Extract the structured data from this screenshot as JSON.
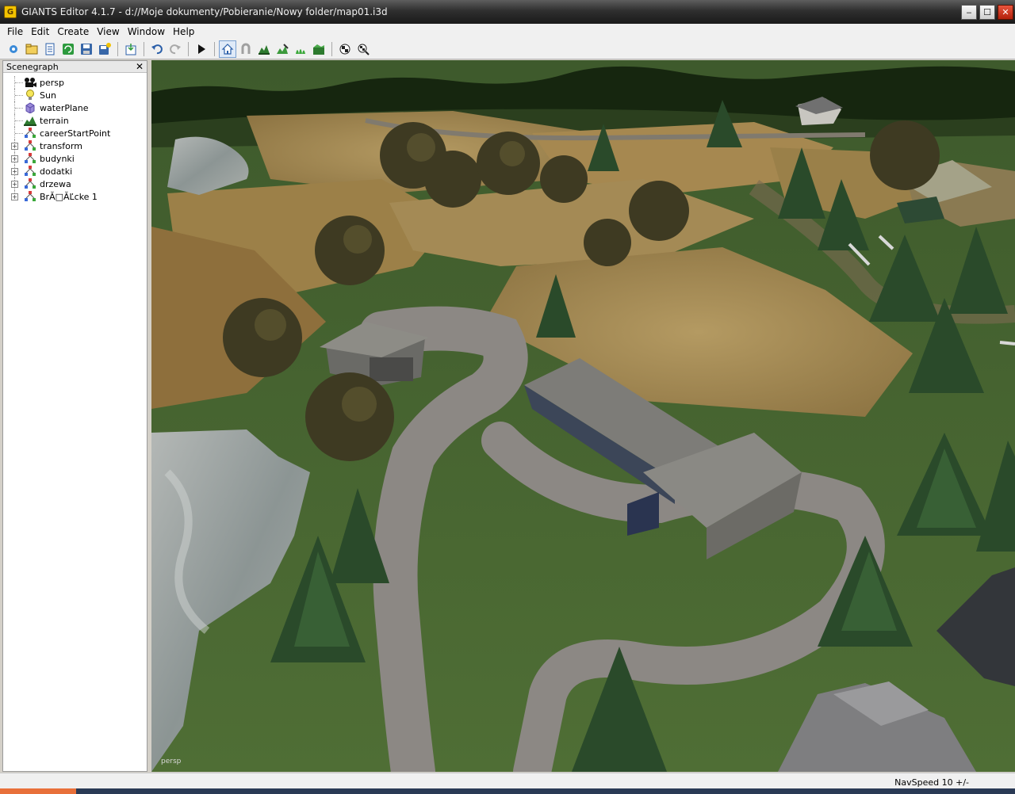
{
  "window": {
    "title": "GIANTS Editor 4.1.7 - d://Moje dokumenty/Pobieranie/Nowy folder/map01.i3d",
    "minimize": "‒",
    "maximize": "☐",
    "close": "✕"
  },
  "menu": [
    "File",
    "Edit",
    "Create",
    "View",
    "Window",
    "Help"
  ],
  "toolbar": {
    "buttons": [
      "new-scene",
      "open",
      "document",
      "refresh",
      "save",
      "save-as",
      "import",
      "undo",
      "redo",
      "play",
      "camera-home",
      "magnet",
      "terrain-sculpt",
      "terrain-paint",
      "foliage-paint",
      "terrain-ops",
      "toggle-a",
      "toggle-b"
    ],
    "active": "camera-home"
  },
  "scenegraph": {
    "title": "Scenegraph",
    "close_label": "✕",
    "items": [
      {
        "label": "persp",
        "icon": "camera-icon",
        "expandable": false
      },
      {
        "label": "Sun",
        "icon": "light-icon",
        "expandable": false
      },
      {
        "label": "waterPlane",
        "icon": "shape-icon",
        "expandable": false
      },
      {
        "label": "terrain",
        "icon": "terrain-icon",
        "expandable": false
      },
      {
        "label": "careerStartPoint",
        "icon": "transform-icon",
        "expandable": false
      },
      {
        "label": "transform",
        "icon": "transform-icon",
        "expandable": true
      },
      {
        "label": "budynki",
        "icon": "transform-icon",
        "expandable": true
      },
      {
        "label": "dodatki",
        "icon": "transform-icon",
        "expandable": true
      },
      {
        "label": "drzewa",
        "icon": "transform-icon",
        "expandable": true
      },
      {
        "label": "BrĂ□ĂĽcke 1",
        "icon": "transform-icon",
        "expandable": true
      }
    ]
  },
  "viewport": {
    "camera_label": "persp"
  },
  "status": {
    "navspeed": "NavSpeed 10 +/-"
  },
  "colors": {
    "title_bar": "#2f2f2f",
    "grass": "#4c6b35",
    "field": "#a48a55",
    "road": "#8c8884",
    "water": "#9aa0a2"
  }
}
